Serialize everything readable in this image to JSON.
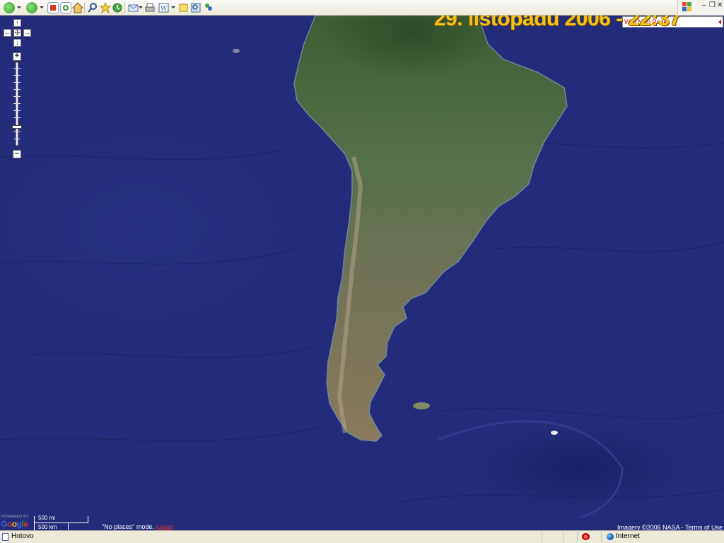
{
  "toolbar": {
    "buttons": [
      "back-icon",
      "forward-icon",
      "stop-icon",
      "refresh-icon",
      "home-icon",
      "search-icon",
      "favorites-icon",
      "history-icon",
      "mail-icon",
      "print-icon",
      "edit-icon",
      "discuss-icon",
      "research-icon",
      "messenger-icon"
    ]
  },
  "map": {
    "date_overlay": "29. listopadu 2006 - 22:37",
    "map_type_label": "Wiki Map Page",
    "ocean_color": "#242b7a",
    "land_color": "#4f6a3e",
    "scale": {
      "miles": "500 mi",
      "km": "500 km"
    },
    "powered_by": "POWERED BY",
    "logo": "Google",
    "mode_text": "\"No places\" mode.",
    "mode_link": "(unset)",
    "copyright": "Imagery ©2006 NASA - ",
    "terms_link": "Terms of Use"
  },
  "statusbar": {
    "status": "Hotovo",
    "zone": "Internet"
  }
}
